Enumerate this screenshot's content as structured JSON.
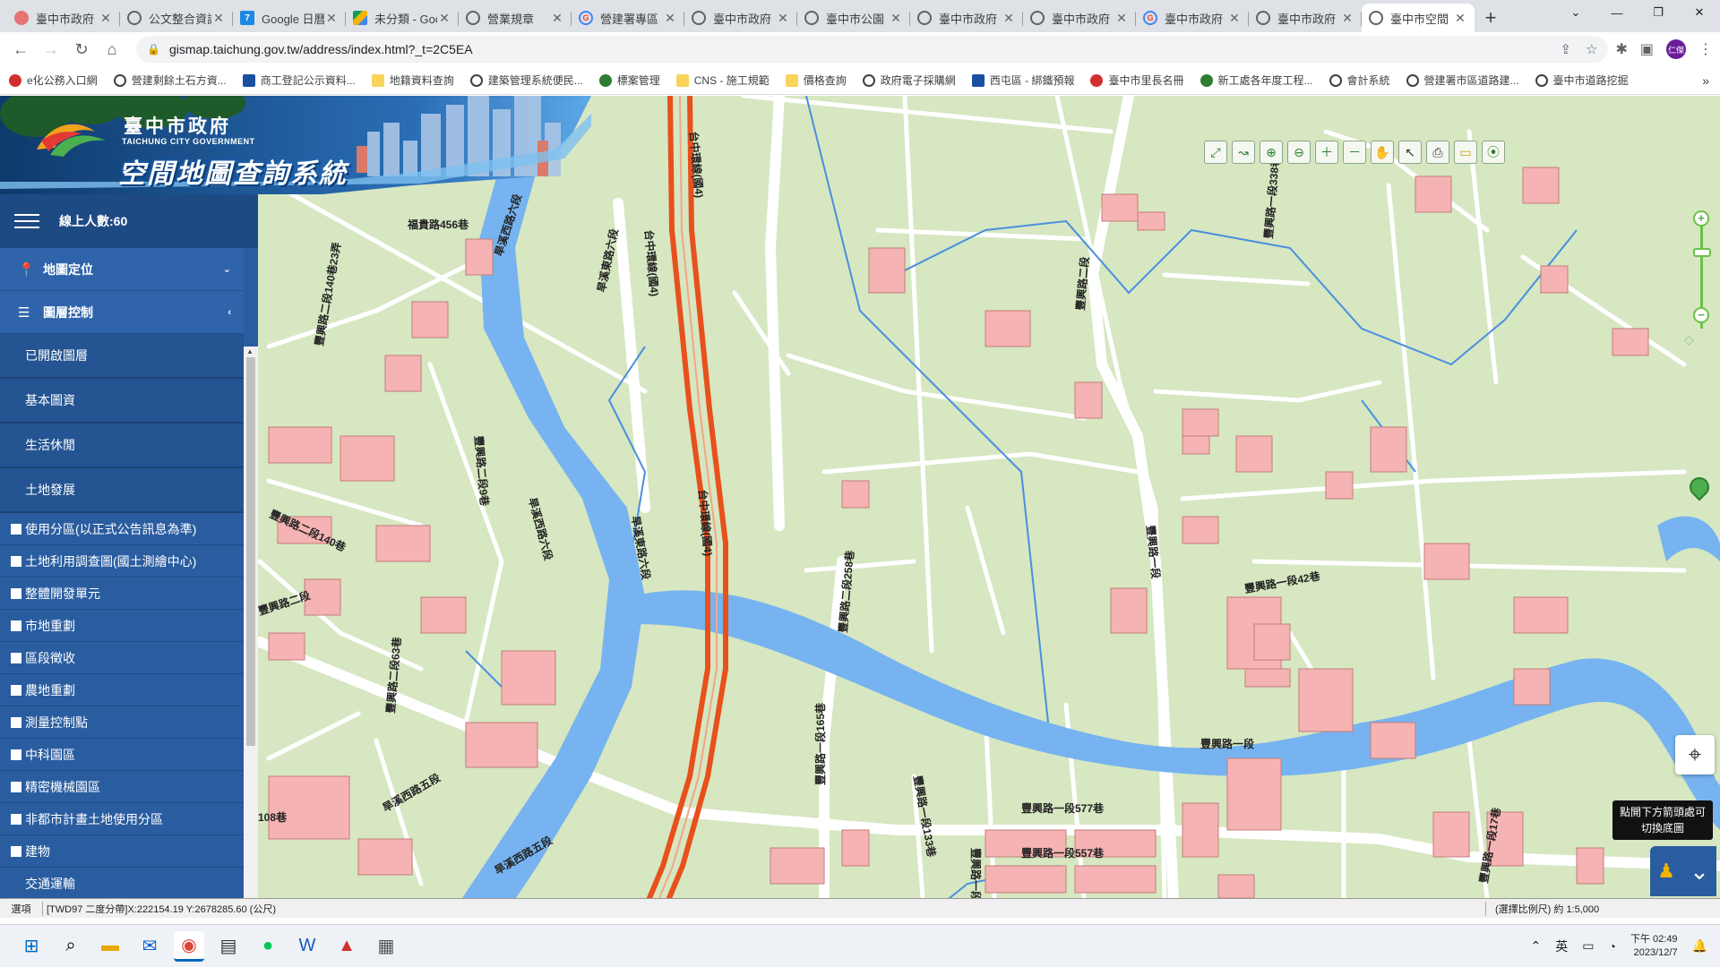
{
  "browser": {
    "tabs": [
      {
        "title": "臺中市政府",
        "icon": "globe-icon",
        "favicon": "G"
      },
      {
        "title": "公文整合資訊",
        "icon": "globe-icon",
        "favicon": ""
      },
      {
        "title": "Google 日曆",
        "icon": "calendar-icon",
        "favicon": "7"
      },
      {
        "title": "未分類 - Google",
        "icon": "drive-icon",
        "favicon": ""
      },
      {
        "title": "營業規章",
        "icon": "globe-icon",
        "favicon": ""
      },
      {
        "title": "營建署專區",
        "icon": "google-icon",
        "favicon": "G"
      },
      {
        "title": "臺中市政府",
        "icon": "globe-icon",
        "favicon": ""
      },
      {
        "title": "臺中市公園",
        "icon": "globe-icon",
        "favicon": ""
      },
      {
        "title": "臺中市政府",
        "icon": "globe-icon",
        "favicon": ""
      },
      {
        "title": "臺中市政府",
        "icon": "globe-icon",
        "favicon": ""
      },
      {
        "title": "臺中市政府",
        "icon": "google-icon",
        "favicon": "G"
      },
      {
        "title": "臺中市政府",
        "icon": "globe-icon",
        "favicon": ""
      },
      {
        "title": "臺中市空間",
        "icon": "globe-icon",
        "favicon": "",
        "active": true
      }
    ],
    "url": "gismap.taichung.gov.tw/address/index.html?_t=2C5EA",
    "profile_initial": "仁傑"
  },
  "bookmarks": [
    {
      "label": "e化公務入口網",
      "icon": "red"
    },
    {
      "label": "營建剩餘土石方資...",
      "icon": "globe"
    },
    {
      "label": "商工登記公示資料...",
      "icon": "blue"
    },
    {
      "label": "地籍資料查詢",
      "icon": "folder"
    },
    {
      "label": "建築管理系統便民...",
      "icon": "globe"
    },
    {
      "label": "標案管理",
      "icon": "green"
    },
    {
      "label": "CNS - 施工規範",
      "icon": "folder"
    },
    {
      "label": "價格查詢",
      "icon": "folder"
    },
    {
      "label": "政府電子採購網",
      "icon": "globe"
    },
    {
      "label": "西屯區 - 綁鐵預報",
      "icon": "blue"
    },
    {
      "label": "臺中市里長名冊",
      "icon": "red"
    },
    {
      "label": "新工處各年度工程...",
      "icon": "green"
    },
    {
      "label": "會計系統",
      "icon": "globe"
    },
    {
      "label": "營建署市區道路建...",
      "icon": "globe"
    },
    {
      "label": "臺中市道路挖掘",
      "icon": "globe"
    }
  ],
  "banner": {
    "gov_title": "臺中市政府",
    "gov_en": "TAICHUNG CITY GOVERNMENT",
    "system_title": "空間地圖查詢系統"
  },
  "sidebar": {
    "online_label": "線上人數:60",
    "menu": [
      {
        "label": "地圖定位",
        "chevron": "⌄"
      },
      {
        "label": "圖層控制",
        "chevron": "‹"
      }
    ],
    "sub_items": [
      "已開啟圖層",
      "基本圖資",
      "生活休閒",
      "土地發展"
    ],
    "layers": [
      "使用分區(以正式公告訊息為準)",
      "土地利用調查圖(國土測繪中心)",
      "整體開發單元",
      "市地重劃",
      "區段徵收",
      "農地重劃",
      "測量控制點",
      "中科園區",
      "精密機械園區",
      "非都市計畫土地使用分區",
      "建物"
    ],
    "last_item": "交通運輸"
  },
  "map": {
    "road_labels": [
      "福貴路456巷",
      "旱溪西路六段",
      "旱溪東路六段",
      "台中環線(國4)",
      "台中環線(國4)",
      "豐興路二段",
      "豐興路二段140巷",
      "豐興路二段140巷23弄",
      "豐興路二段9巷",
      "旱溪西路六段",
      "旱溪東路六段",
      "台中環線(國4)",
      "豐興路二段258巷",
      "豐興路二段",
      "豐興路一段",
      "豐興路一段42巷",
      "豐興路一段338巷",
      "豐興路二段63巷",
      "旱溪西路五段",
      "旱溪西路五段",
      "豐興路一段577巷",
      "豐興路一段557巷",
      "豐興路一段113巷",
      "豐興路一段165巷",
      "豐興路一段133巷",
      "豐興路一段17巷",
      "108巷",
      "豐興路一段"
    ],
    "tools": [
      "extent-icon",
      "measure-icon",
      "zoom-in-area-icon",
      "zoom-out-area-icon",
      "zoom-in-icon",
      "zoom-out-icon",
      "identify-icon",
      "select-icon",
      "print-icon",
      "ruler-icon",
      "marker-icon"
    ],
    "basemap_tip_line1": "點開下方箭頭處可",
    "basemap_tip_line2": "切換底圖"
  },
  "status": {
    "select": "選項",
    "coords": "[TWD97 二度分帶]X:222154.19 Y:2678285.60 (公尺)",
    "scale": "(選擇比例尺) 約 1:5,000"
  },
  "taskbar": {
    "tray_lang": "英",
    "time": "下午 02:49",
    "date": "2023/12/7"
  },
  "colors": {
    "sidebar_bg": "#2a5da0",
    "map_bg": "#d6e7c1",
    "river": "#76b3f0",
    "highway": "#e8501c",
    "building": "#f5b3b3"
  }
}
